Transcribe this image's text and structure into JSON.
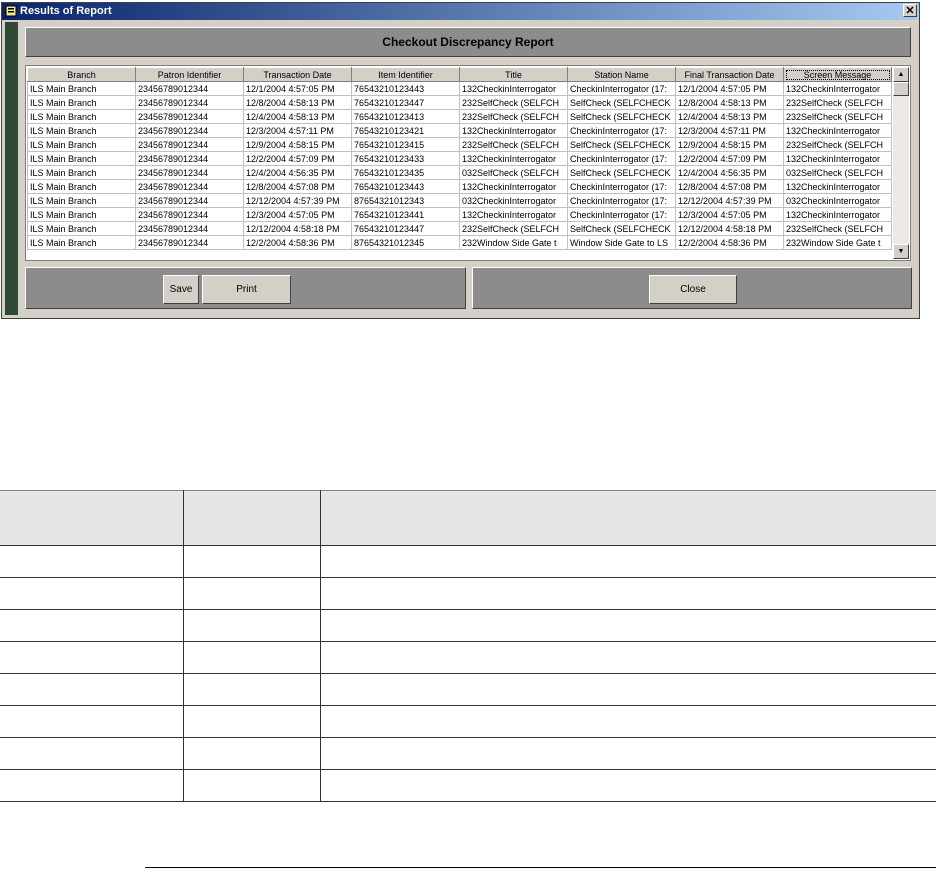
{
  "window": {
    "title": "Results of Report",
    "close_glyph": "✕"
  },
  "report": {
    "title": "Checkout Discrepancy Report"
  },
  "grid": {
    "columns": [
      "Branch",
      "Patron Identifier",
      "Transaction Date",
      "Item Identifier",
      "Title",
      "Station Name",
      "Final Transaction Date",
      "Screen Message"
    ],
    "rows": [
      [
        "ILS Main Branch",
        "23456789012344",
        "12/1/2004 4:57:05 PM",
        "76543210123443",
        "132CheckinInterrogator",
        "CheckinInterrogator (17:",
        "12/1/2004 4:57:05 PM",
        "132CheckinInterrogator"
      ],
      [
        "ILS Main Branch",
        "23456789012344",
        "12/8/2004 4:58:13 PM",
        "76543210123447",
        "232SelfCheck (SELFCH",
        "SelfCheck (SELFCHECK",
        "12/8/2004 4:58:13 PM",
        "232SelfCheck (SELFCH"
      ],
      [
        "ILS Main Branch",
        "23456789012344",
        "12/4/2004 4:58:13 PM",
        "76543210123413",
        "232SelfCheck (SELFCH",
        "SelfCheck (SELFCHECK",
        "12/4/2004 4:58:13 PM",
        "232SelfCheck (SELFCH"
      ],
      [
        "ILS Main Branch",
        "23456789012344",
        "12/3/2004 4:57:11 PM",
        "76543210123421",
        "132CheckinInterrogator",
        "CheckinInterrogator (17:",
        "12/3/2004 4:57:11 PM",
        "132CheckinInterrogator"
      ],
      [
        "ILS Main Branch",
        "23456789012344",
        "12/9/2004 4:58:15 PM",
        "76543210123415",
        "232SelfCheck (SELFCH",
        "SelfCheck (SELFCHECK",
        "12/9/2004 4:58:15 PM",
        "232SelfCheck (SELFCH"
      ],
      [
        "ILS Main Branch",
        "23456789012344",
        "12/2/2004 4:57:09 PM",
        "76543210123433",
        "132CheckinInterrogator",
        "CheckinInterrogator (17:",
        "12/2/2004 4:57:09 PM",
        "132CheckinInterrogator"
      ],
      [
        "ILS Main Branch",
        "23456789012344",
        "12/4/2004 4:56:35 PM",
        "76543210123435",
        "032SelfCheck (SELFCH",
        "SelfCheck (SELFCHECK",
        "12/4/2004 4:56:35 PM",
        "032SelfCheck (SELFCH"
      ],
      [
        "ILS Main Branch",
        "23456789012344",
        "12/8/2004 4:57:08 PM",
        "76543210123443",
        "132CheckinInterrogator",
        "CheckinInterrogator (17:",
        "12/8/2004 4:57:08 PM",
        "132CheckinInterrogator"
      ],
      [
        "ILS Main Branch",
        "23456789012344",
        "12/12/2004 4:57:39 PM",
        "87654321012343",
        "032CheckinInterrogator",
        "CheckinInterrogator (17:",
        "12/12/2004 4:57:39 PM",
        "032CheckinInterrogator"
      ],
      [
        "ILS Main Branch",
        "23456789012344",
        "12/3/2004 4:57:05 PM",
        "76543210123441",
        "132CheckinInterrogator",
        "CheckinInterrogator (17:",
        "12/3/2004 4:57:05 PM",
        "132CheckinInterrogator"
      ],
      [
        "ILS Main Branch",
        "23456789012344",
        "12/12/2004 4:58:18 PM",
        "76543210123447",
        "232SelfCheck (SELFCH",
        "SelfCheck (SELFCHECK",
        "12/12/2004 4:58:18 PM",
        "232SelfCheck (SELFCH"
      ],
      [
        "ILS Main Branch",
        "23456789012344",
        "12/2/2004 4:58:36 PM",
        "87654321012345",
        "232Window Side Gate t",
        "Window Side Gate to LS",
        "12/2/2004 4:58:36 PM",
        "232Window Side Gate t"
      ]
    ]
  },
  "scrollbar": {
    "up_glyph": "▲",
    "down_glyph": "▼"
  },
  "buttons": {
    "save": "Save",
    "print": "Print",
    "close": "Close"
  }
}
